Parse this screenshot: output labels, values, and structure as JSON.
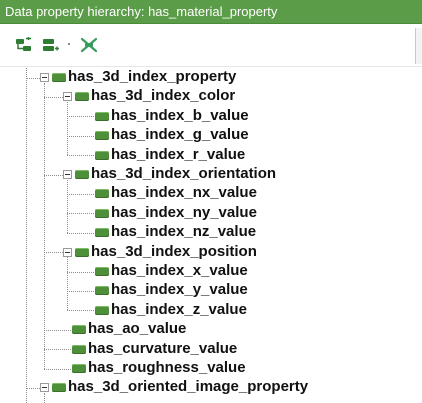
{
  "panel": {
    "title": "Data property hierarchy: has_material_property"
  },
  "toolbar": {
    "add_subproperty_icon": "add-subproperty-icon",
    "add_sibling_icon": "add-sibling-property-icon",
    "delete_icon": "delete-property-icon"
  },
  "colors": {
    "title_bar": "#5b9c49",
    "node_icon": "#4e8f3a",
    "toolbar_icon": "#2f7d32",
    "delete_icon": "#3a9c5c"
  },
  "tree": {
    "nodes": [
      {
        "label": "has_3d_index_property",
        "depth": 0,
        "expanded": true
      },
      {
        "label": "has_3d_index_color",
        "depth": 1,
        "expanded": true
      },
      {
        "label": "has_index_b_value",
        "depth": 2
      },
      {
        "label": "has_index_g_value",
        "depth": 2
      },
      {
        "label": "has_index_r_value",
        "depth": 2
      },
      {
        "label": "has_3d_index_orientation",
        "depth": 1,
        "expanded": true
      },
      {
        "label": "has_index_nx_value",
        "depth": 2
      },
      {
        "label": "has_index_ny_value",
        "depth": 2
      },
      {
        "label": "has_index_nz_value",
        "depth": 2
      },
      {
        "label": "has_3d_index_position",
        "depth": 1,
        "expanded": true
      },
      {
        "label": "has_index_x_value",
        "depth": 2
      },
      {
        "label": "has_index_y_value",
        "depth": 2
      },
      {
        "label": "has_index_z_value",
        "depth": 2
      },
      {
        "label": "has_ao_value",
        "depth": 1
      },
      {
        "label": "has_curvature_value",
        "depth": 1
      },
      {
        "label": "has_roughness_value",
        "depth": 1
      },
      {
        "label": "has_3d_oriented_image_property",
        "depth": 0,
        "expanded": true
      }
    ]
  }
}
